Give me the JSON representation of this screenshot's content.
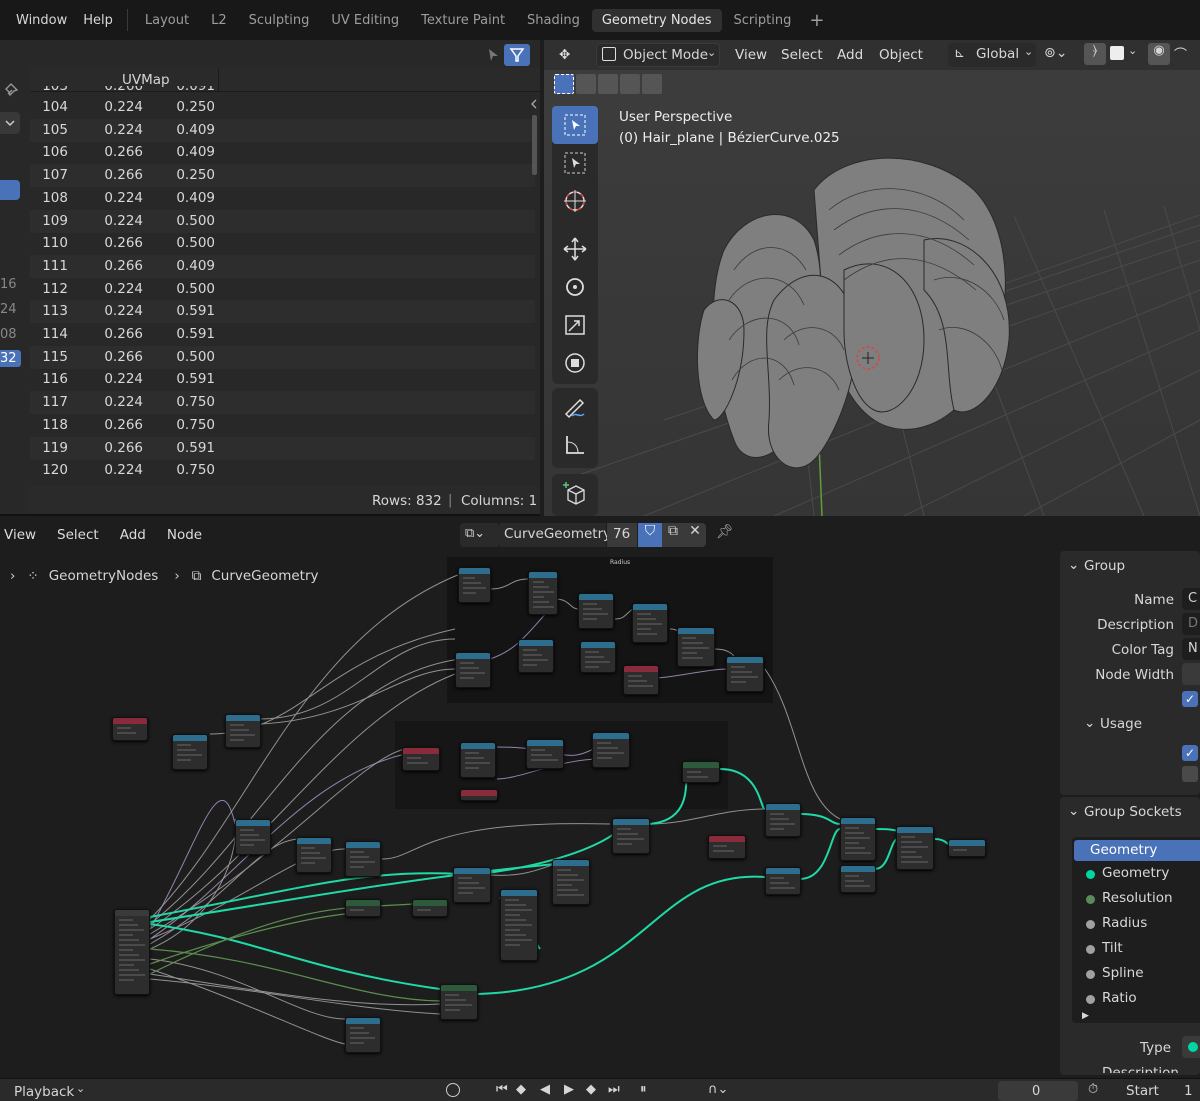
{
  "topbar": {
    "menus": [
      "Window",
      "Help"
    ],
    "workspaces": [
      "Layout",
      "L2",
      "Sculpting",
      "UV Editing",
      "Texture Paint",
      "Shading",
      "Geometry Nodes",
      "Scripting"
    ],
    "active_workspace": "Geometry Nodes",
    "add_tab": "+"
  },
  "spreadsheet": {
    "column_header": "UVMap",
    "rows": [
      {
        "idx": "104",
        "u": "0.224",
        "v": "0.250"
      },
      {
        "idx": "105",
        "u": "0.224",
        "v": "0.409"
      },
      {
        "idx": "106",
        "u": "0.266",
        "v": "0.409"
      },
      {
        "idx": "107",
        "u": "0.266",
        "v": "0.250"
      },
      {
        "idx": "108",
        "u": "0.224",
        "v": "0.409"
      },
      {
        "idx": "109",
        "u": "0.224",
        "v": "0.500"
      },
      {
        "idx": "110",
        "u": "0.266",
        "v": "0.500"
      },
      {
        "idx": "111",
        "u": "0.266",
        "v": "0.409"
      },
      {
        "idx": "112",
        "u": "0.224",
        "v": "0.500"
      },
      {
        "idx": "113",
        "u": "0.224",
        "v": "0.591"
      },
      {
        "idx": "114",
        "u": "0.266",
        "v": "0.591"
      },
      {
        "idx": "115",
        "u": "0.266",
        "v": "0.500"
      },
      {
        "idx": "116",
        "u": "0.224",
        "v": "0.591"
      },
      {
        "idx": "117",
        "u": "0.224",
        "v": "0.750"
      },
      {
        "idx": "118",
        "u": "0.266",
        "v": "0.750"
      },
      {
        "idx": "119",
        "u": "0.266",
        "v": "0.591"
      },
      {
        "idx": "120",
        "u": "0.224",
        "v": "0.750"
      }
    ],
    "partial_top_row": {
      "idx": "103",
      "u": "0.266",
      "v": "0.091"
    },
    "left_numbers": [
      "16",
      "24",
      "08",
      "32"
    ],
    "footer": {
      "rows": "Rows: 832",
      "columns": "Columns: 1"
    }
  },
  "viewport": {
    "mode": "Object Mode",
    "menus": [
      "View",
      "Select",
      "Add",
      "Object"
    ],
    "transform": "Global",
    "overlay_title": "User Perspective",
    "overlay_object": "(0) Hair_plane | BézierCurve.025"
  },
  "node_editor": {
    "menus": [
      "View",
      "Select",
      "Add",
      "Node"
    ],
    "node_tree_name": "CurveGeometry",
    "users": "76",
    "breadcrumb": [
      "GeometryNodes",
      "CurveGeometry"
    ],
    "frame_title": "Radius"
  },
  "sidebar": {
    "group_header": "Group",
    "fields": [
      {
        "label": "Name",
        "value": "C"
      },
      {
        "label": "Description",
        "value": "D"
      },
      {
        "label": "Color Tag",
        "value": "N"
      },
      {
        "label": "Node Width",
        "value": ""
      }
    ],
    "usage_header": "Usage",
    "sockets_header": "Group Sockets",
    "selected_socket": "Geometry",
    "sockets": [
      {
        "name": "Geometry",
        "color": "#00d6a3"
      },
      {
        "name": "Resolution",
        "color": "#598c5c"
      },
      {
        "name": "Radius",
        "color": "#a1a1a1"
      },
      {
        "name": "Tilt",
        "color": "#a1a1a1"
      },
      {
        "name": "Spline",
        "color": "#a1a1a1"
      },
      {
        "name": "Ratio",
        "color": "#a1a1a1"
      }
    ],
    "type_label": "Type",
    "description_label": "Description"
  },
  "timeline": {
    "playback": "Playback",
    "frame": "0",
    "start_label": "Start",
    "start_value": "1"
  },
  "colors": {
    "accent": "#4a72b8",
    "geometry_socket": "#00d6a3",
    "node_header_blue": "#2d6e8e",
    "node_header_red": "#8a2b3b",
    "node_header_green": "#2d5a3a"
  }
}
